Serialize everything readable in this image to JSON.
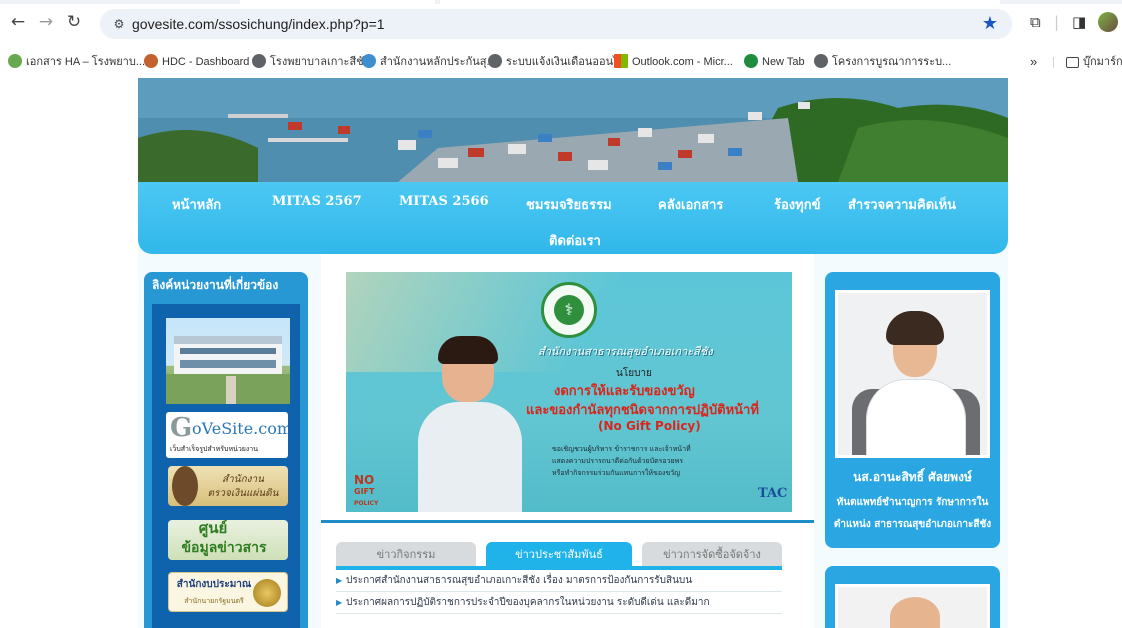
{
  "browser": {
    "url": "govesite.com/ssosichung/index.php?p=1",
    "bookmarks": [
      "เอกสาร HA – โรงพยาบ...",
      "HDC - Dashboard",
      "โรงพยาบาลเกาะสีชัง",
      "สำนักงานหลักประกันสุ...",
      "ระบบแจ้งเงินเดือนออนไ...",
      "Outlook.com - Micr...",
      "New Tab",
      "โครงการบูรณาการระบ..."
    ],
    "more_bookmarks": "»",
    "all_bookmarks": "บุ๊กมาร์กทั้งหมด"
  },
  "menu": {
    "items": [
      "หน้าหลัก",
      "MITAS 2567",
      "MITAS 2566",
      "ชมรมจริยธรรม",
      "คลังเอกสาร",
      "ร้องทุกข์",
      "สำรวจความคิดเห็น"
    ],
    "row2": "ติดต่อเรา"
  },
  "left": {
    "title": "ลิงค์หน่วยงานที่เกี่ยวข้อง",
    "govesite_big": "G",
    "govesite_word": "oVeSite.com",
    "govesite_sub": "เว็บสำเร็จรูปสำหรับหน่วยงาน",
    "audit_line1": "สำนักงาน",
    "audit_line2": "ตรวจเงินแผ่นดิน",
    "info_line1": "ศูนย์",
    "info_line2": "ข้อมูลข่าวสาร",
    "budget_line1": "สำนักงบประมาณ",
    "budget_line2": "สำนักนายกรัฐมนตรี"
  },
  "poster": {
    "office": "สำนักงานสาธารณสุขอำเภอเกาะสีชัง",
    "policy": "นโยบาย",
    "line1": "งดการให้และรับของขวัญ",
    "line2": "และของกำนัลทุกชนิดจากการปฏิบัติหน้าที่",
    "line3": "(No Gift Policy)",
    "small1": "ขอเชิญชวนผู้บริหาร ข้าราชการ และเจ้าหน้าที่",
    "small2": "แสดงความปรารถนาดีต่อกันด้วยบัตรอวยพร",
    "small3": "หรือทำกิจกรรมร่วมกันแทนการให้ของขวัญ",
    "nogift1": "NO",
    "nogift2": "GIFT",
    "nogift3": "POLICY",
    "tac": "TAC"
  },
  "tabs": [
    "ข่าวกิจกรรม",
    "ข่าวประชาสัมพันธ์",
    "ข่าวการจัดซื้อจัดจ้าง"
  ],
  "news": [
    "ประกาศสำนักงานสาธารณสุขอำเภอเกาะสีชัง เรื่อง มาตรการป้องกันการรับสินบน",
    "ประกาศผลการปฏิบัติราชการประจำปีของบุคลากรในหน่วยงาน ระดับดีเด่น และดีมาก"
  ],
  "profile": {
    "name": "นส.อานะสิทธิ์ ศัลยพงษ์",
    "title": "ทันตแพทย์ชำนาญการ รักษาการในตำแหน่ง สาธารณสุขอำเภอเกาะสีชัง"
  },
  "colors": {
    "menu": "#31b7ea",
    "left_panel": "#0e63ac",
    "profile_box": "#2aa7e3",
    "active_tab": "#1fb3ea"
  }
}
